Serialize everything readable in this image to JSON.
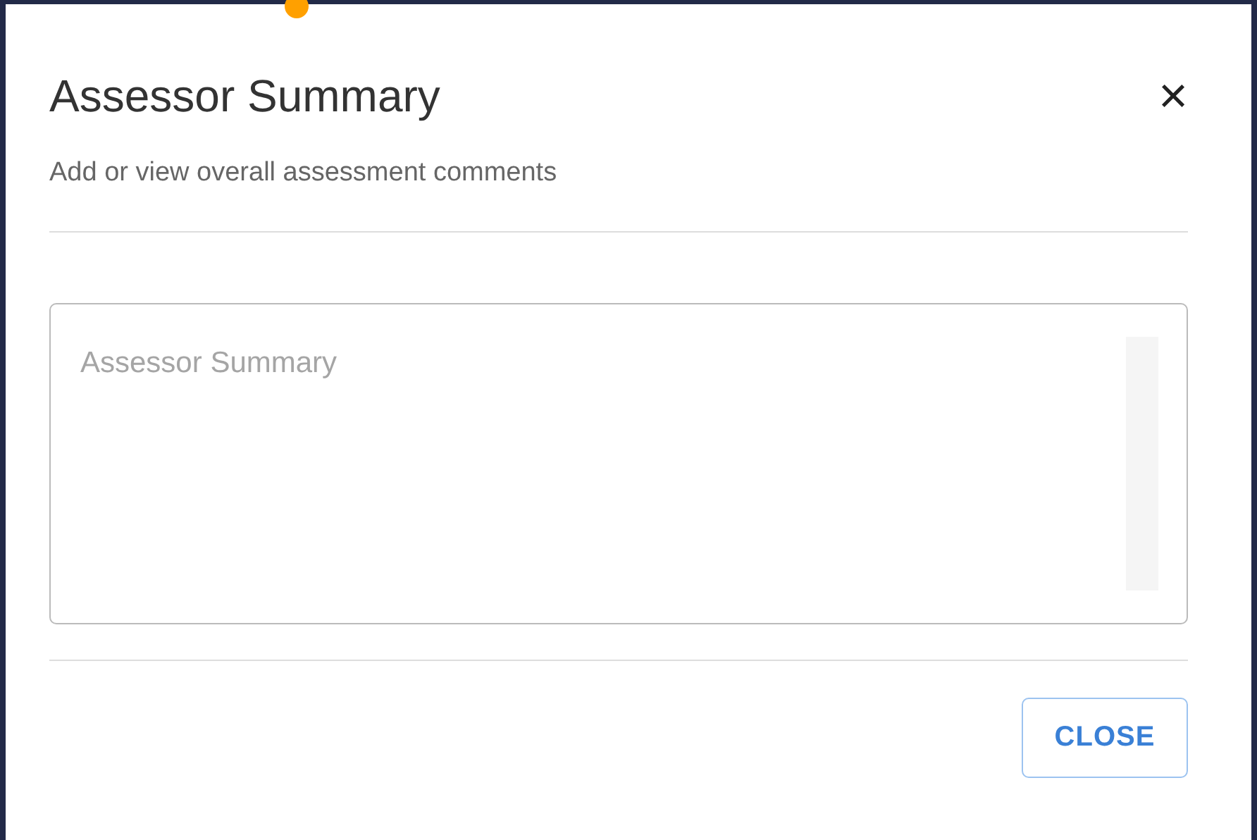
{
  "dialog": {
    "title": "Assessor Summary",
    "close_icon": "×",
    "subtitle": "Add or view overall assessment comments",
    "summary_field": {
      "placeholder": "Assessor Summary"
    },
    "buttons": [
      {
        "label": "CLOSE"
      }
    ]
  }
}
